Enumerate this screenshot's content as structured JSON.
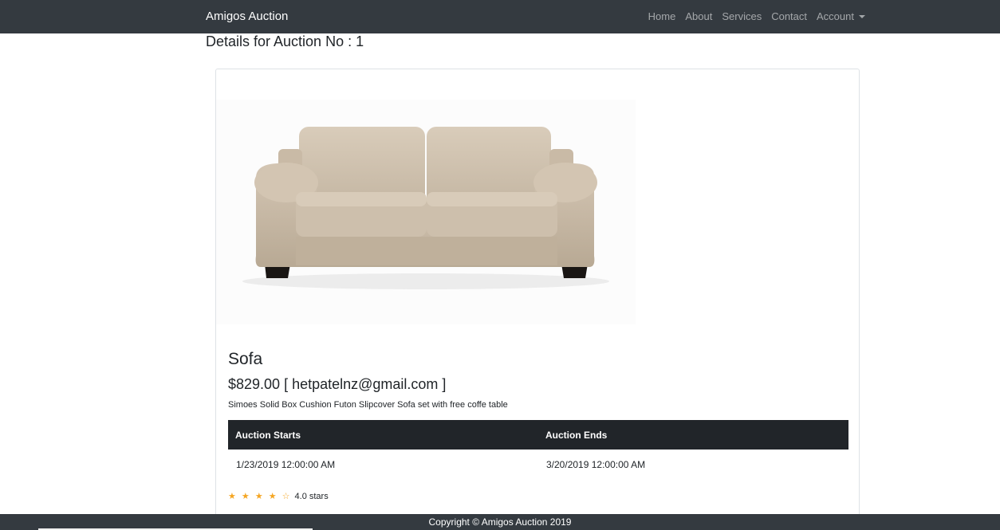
{
  "navbar": {
    "brand": "Amigos Auction",
    "links": [
      "Home",
      "About",
      "Services",
      "Contact"
    ],
    "account_label": "Account"
  },
  "page": {
    "heading": "Details for Auction No : 1"
  },
  "item": {
    "image_alt": "Sofa",
    "title": "Sofa",
    "price_line": "$829.00 [ hetpatelnz@gmail.com ]",
    "description": "Simoes Solid Box Cushion Futon Slipcover Sofa set with free coffe table"
  },
  "table": {
    "headers": [
      "Auction Starts",
      "Auction Ends"
    ],
    "row": [
      "1/23/2019 12:00:00 AM",
      "3/20/2019 12:00:00 AM"
    ]
  },
  "rating": {
    "stars": "★ ★ ★ ★ ☆",
    "value": 4.0,
    "text": "4.0 stars"
  },
  "footer": {
    "text": "Copyright © Amigos Auction 2019"
  },
  "colors": {
    "navbar_bg": "#343a40",
    "table_header_bg": "#212529",
    "star": "#f5a623"
  }
}
